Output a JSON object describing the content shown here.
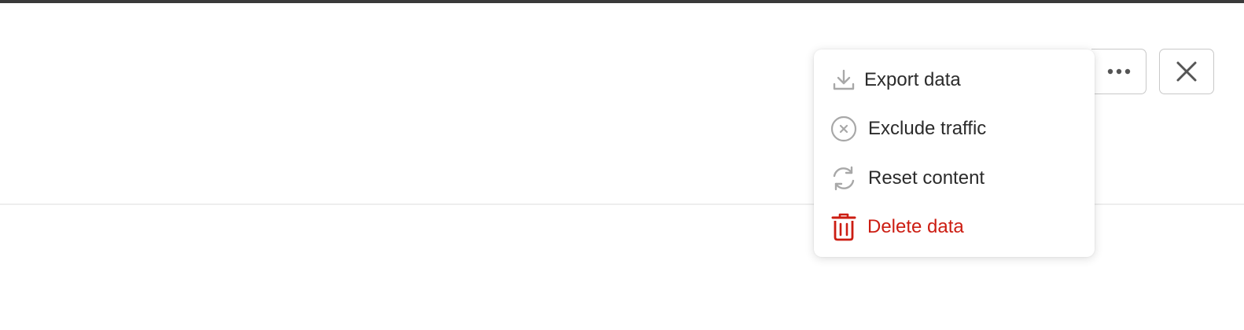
{
  "toolbar": {
    "more_icon": "more-horizontal-icon",
    "close_icon": "close-icon"
  },
  "menu": {
    "items": [
      {
        "label": "Export data",
        "icon": "download-icon"
      },
      {
        "label": "Exclude traffic",
        "icon": "circle-x-icon"
      },
      {
        "label": "Reset content",
        "icon": "refresh-icon"
      },
      {
        "label": "Delete data",
        "icon": "trash-icon",
        "color": "#cc1d12"
      }
    ]
  },
  "colors": {
    "danger": "#cc1d12",
    "icon_gray": "#a8a8a8",
    "text": "#2b2b2b"
  }
}
